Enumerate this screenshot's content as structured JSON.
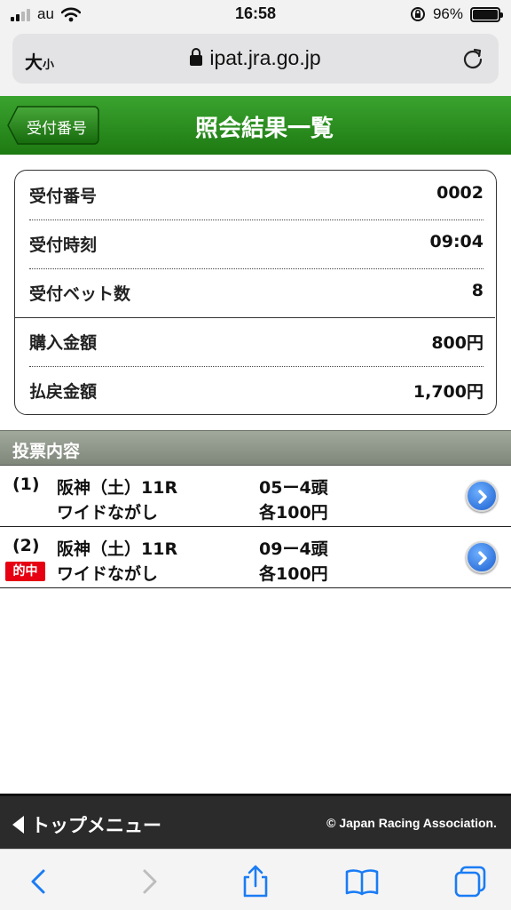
{
  "status_bar": {
    "carrier": "au",
    "time": "16:58",
    "battery": "96%"
  },
  "browser": {
    "text_size_big": "大",
    "text_size_small": "小",
    "url": "ipat.jra.go.jp"
  },
  "header": {
    "back_label": "受付番号",
    "title": "照会結果一覧"
  },
  "summary": {
    "rows": [
      {
        "label": "受付番号",
        "value": "0002"
      },
      {
        "label": "受付時刻",
        "value": "09:04"
      },
      {
        "label": "受付ベット数",
        "value": "8"
      },
      {
        "label": "購入金額",
        "value": "800円"
      },
      {
        "label": "払戻金額",
        "value": "1,700円"
      }
    ]
  },
  "section": {
    "title": "投票内容"
  },
  "bets": [
    {
      "num": "(1)",
      "race": "阪神（土）11R",
      "combo": "05ー4頭",
      "type": "ワイドながし",
      "amount": "各100円",
      "badge": ""
    },
    {
      "num": "(2)",
      "race": "阪神（土）11R",
      "combo": "09ー4頭",
      "type": "ワイドながし",
      "amount": "各100円",
      "badge": "的中"
    }
  ],
  "footer": {
    "top_menu": "トップメニュー",
    "copyright": "© Japan Racing Association."
  },
  "colors": {
    "header_green": "#1e7a12",
    "hit_red": "#e60012",
    "arrow_blue": "#1a5fd0"
  },
  "icons": [
    "wifi-icon",
    "lock-icon",
    "reload-icon",
    "chevron-right-icon",
    "back-icon",
    "forward-icon",
    "share-icon",
    "bookmarks-icon",
    "tabs-icon"
  ]
}
